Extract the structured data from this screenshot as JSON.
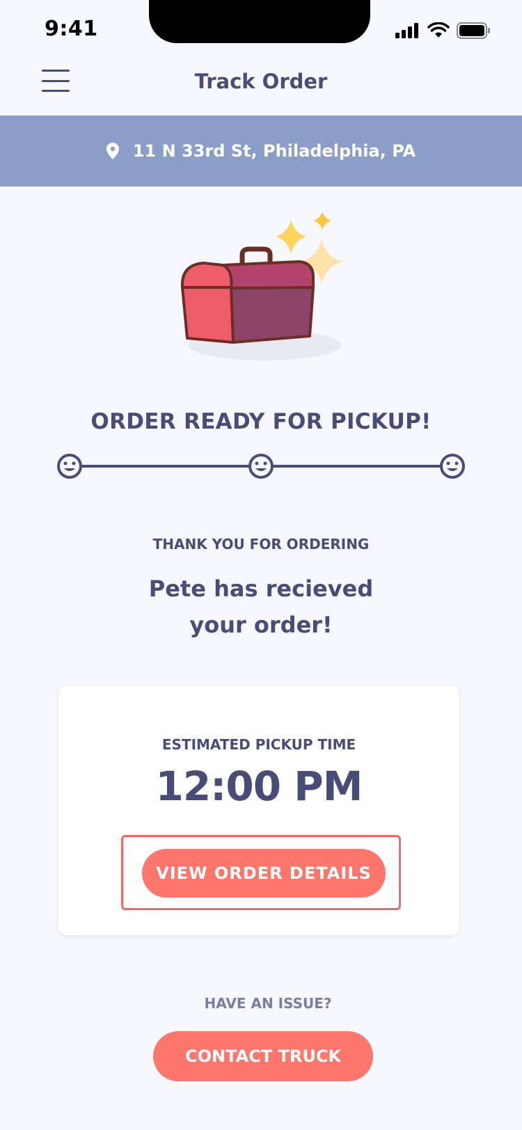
{
  "status_bar": {
    "time": "9:41"
  },
  "header": {
    "title": "Track Order",
    "menu_icon": "hamburger-menu-icon"
  },
  "location": {
    "address": "11 N 33rd St, Philadelphia, PA",
    "icon": "map-pin-icon"
  },
  "colors": {
    "location_bar": "#8a9ec8",
    "primary_text": "#4a4c78",
    "accent_button": "#ff766c",
    "focus_outline": "#f06a63",
    "background": "#f7f8fd"
  },
  "order_status": {
    "title": "ORDER READY FOR PICKUP!",
    "progress_steps": 3,
    "completed_steps": 3,
    "step_icon": "smiley-face-icon"
  },
  "message": {
    "label": "THANK YOU FOR ORDERING",
    "line1": "Pete has recieved",
    "line2": "your order!"
  },
  "pickup_card": {
    "label": "ESTIMATED PICKUP TIME",
    "time": "12:00 PM",
    "button_label": "VIEW ORDER DETAILS"
  },
  "support": {
    "label": "HAVE AN ISSUE?",
    "button_label": "CONTACT TRUCK"
  }
}
